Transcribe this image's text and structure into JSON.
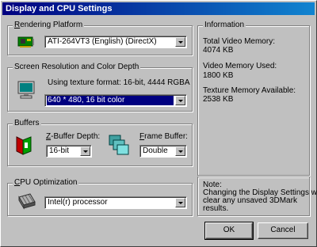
{
  "window": {
    "title": "Display and CPU Settings"
  },
  "rendering": {
    "title_prefix": "",
    "title_accel": "R",
    "title_rest": "endering Platform",
    "selected": "ATI-264VT3 (English) (DirectX)"
  },
  "resolution": {
    "title": "Screen Resolution and Color Depth",
    "texture_format": "Using texture format: 16-bit, 4444 RGBA",
    "selected": "640 * 480, 16 bit color"
  },
  "buffers": {
    "title": "Buffers",
    "zbuffer_label_accel": "Z",
    "zbuffer_label_rest": "-Buffer Depth:",
    "zbuffer_value": "16-bit",
    "frame_label_accel": "F",
    "frame_label_rest": "rame Buffer:",
    "frame_value": "Double"
  },
  "cpu": {
    "title_accel": "C",
    "title_rest": "PU Optimization",
    "selected": "Intel(r) processor"
  },
  "info": {
    "title": "Information",
    "total_label": "Total Video Memory:",
    "total_value": "4074 KB",
    "used_label": "Video Memory Used:",
    "used_value": "1800 KB",
    "texture_label": "Texture Memory Available:",
    "texture_value": "2538 KB"
  },
  "note": {
    "title": "Note:",
    "line1": "Changing the Display Settings will",
    "line2": "clear any unsaved 3DMark",
    "line3": "results."
  },
  "buttons": {
    "ok": "OK",
    "cancel": "Cancel"
  }
}
